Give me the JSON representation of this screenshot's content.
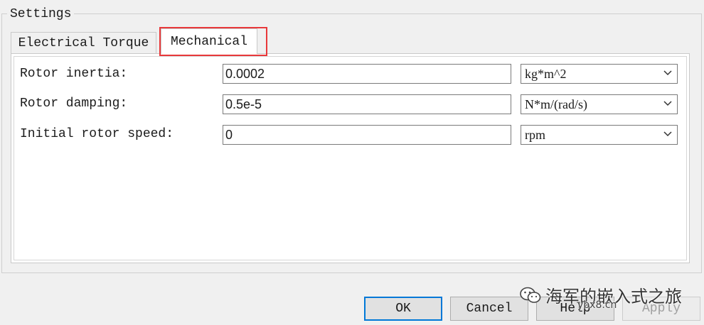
{
  "settings": {
    "title": "Settings",
    "tabs": [
      {
        "label": "Electrical Torque",
        "active": false
      },
      {
        "label": "Mechanical",
        "active": true
      }
    ],
    "highlight_color": "#e8383a"
  },
  "fields": [
    {
      "label": "Rotor inertia:",
      "value": "0.0002",
      "unit": "kg*m^2"
    },
    {
      "label": "Rotor damping:",
      "value": "0.5e-5",
      "unit": "N*m/(rad/s)"
    },
    {
      "label": "Initial rotor speed:",
      "value": "0",
      "unit": "rpm"
    }
  ],
  "buttons": {
    "ok": "OK",
    "cancel": "Cancel",
    "help": "Help",
    "apply": "Apply"
  },
  "watermark": {
    "text": "海军的嵌入式之旅",
    "subtext": "ybx8.cn",
    "icon": "wechat-icon"
  }
}
